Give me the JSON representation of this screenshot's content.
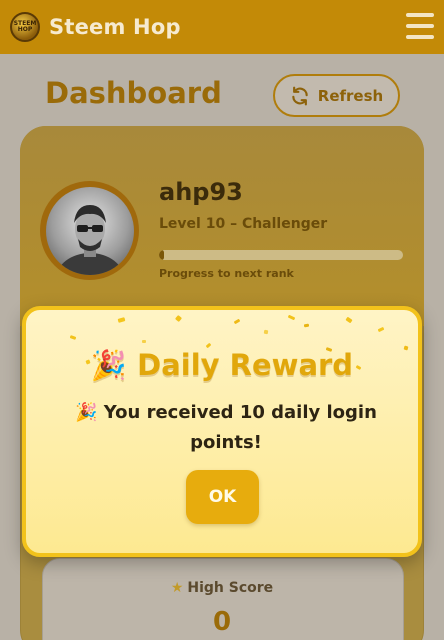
{
  "header": {
    "app_title": "Steem Hop",
    "logo_text": "STEEM HOP"
  },
  "dashboard": {
    "title": "Dashboard",
    "refresh_label": "Refresh"
  },
  "profile": {
    "username": "ahp93",
    "rank": "Level 10 – Challenger",
    "progress_label": "Progress to next rank",
    "progress_fraction": 0.02
  },
  "stats": {
    "high_score_label": "High Score",
    "high_score_value": "0"
  },
  "modal": {
    "title_emoji": "🎉",
    "title": "Daily Reward",
    "message_emoji": "🎉",
    "message": "You received 10 daily login points!",
    "ok_label": "OK"
  },
  "colors": {
    "header_bg": "#c38a07",
    "accent": "#e1a70b",
    "modal_border": "#f2c21b",
    "ok_button": "#e7ac0d"
  },
  "icons": [
    "steem-hop-logo",
    "menu-icon",
    "refresh-icon",
    "star-icon",
    "party-popper-icon"
  ]
}
